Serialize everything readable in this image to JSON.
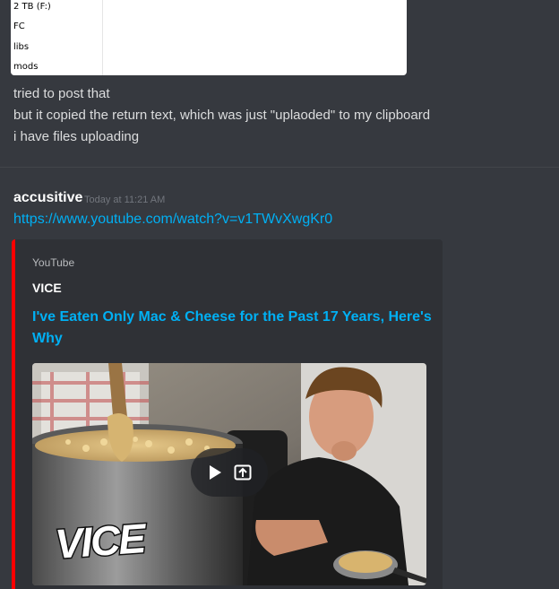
{
  "attachment": {
    "entries": [
      "2 TB (F:)",
      "FC",
      "libs",
      "mods"
    ]
  },
  "messages_prev": [
    "tried to post that",
    "but it copied the return text, which was just \"uplaoded\" to my clipboard",
    "i have files uploading"
  ],
  "message": {
    "username": "accusitive",
    "timestamp": "Today at 11:21 AM",
    "link": "https://www.youtube.com/watch?v=v1TWvXwgKr0"
  },
  "embed": {
    "provider": "YouTube",
    "author": "VICE",
    "title": "I've Eaten Only Mac & Cheese for the Past 17 Years, Here's Why",
    "thumbnail_logo": "VICE",
    "accent_color": "#ff0000",
    "icons": [
      "play-icon",
      "external-link-icon"
    ]
  },
  "colors": {
    "background": "#36393f",
    "embed_background": "#2f3136",
    "link": "#00b0f4",
    "text": "#dcddde",
    "timestamp": "#72767d"
  }
}
